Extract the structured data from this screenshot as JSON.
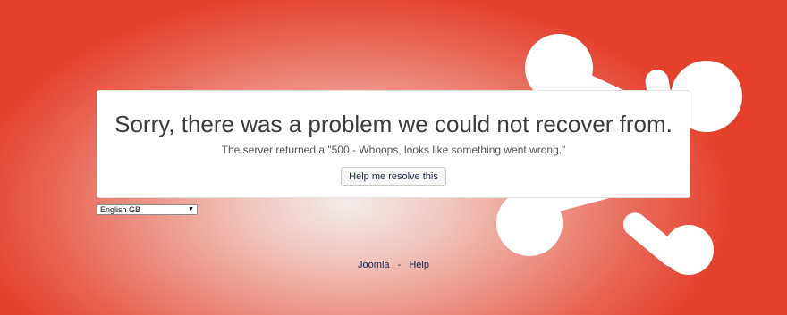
{
  "error": {
    "title": "Sorry, there was a problem we could not recover from.",
    "message": "The server returned a \"500 - Whoops, looks like something went wrong.\"",
    "button_label": "Help me resolve this"
  },
  "language_select": {
    "selected": "English GB",
    "icon": "chevron-down-icon"
  },
  "footer": {
    "links": [
      "Joomla",
      "Help"
    ],
    "separator": "-"
  },
  "colors": {
    "background_edge": "#e4412c",
    "background_center": "#f2ecea",
    "card": "#ffffff",
    "logo": "#ffffff"
  }
}
